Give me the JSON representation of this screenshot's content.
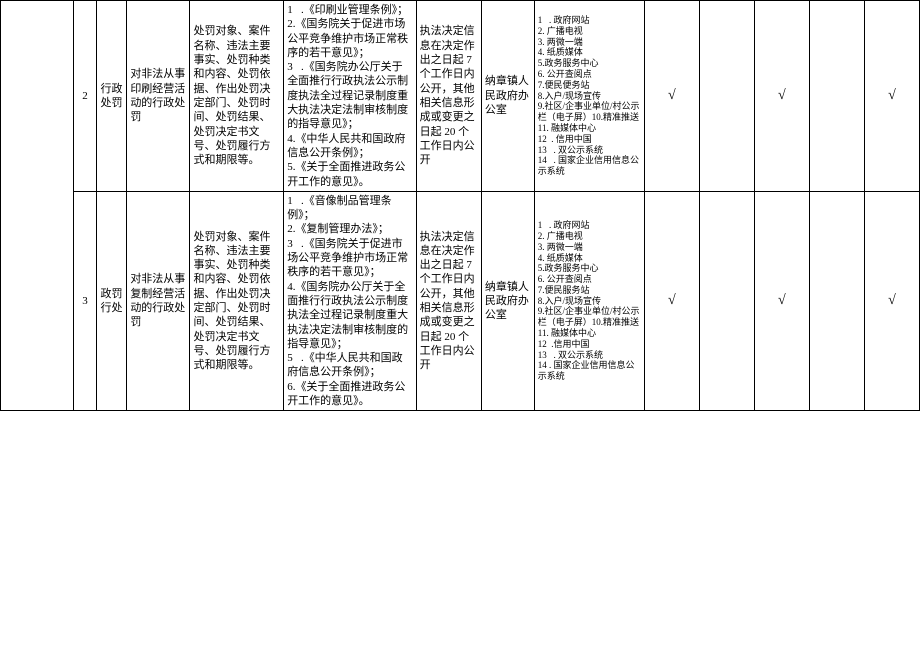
{
  "rows": [
    {
      "num": "2",
      "category": "行政处罚",
      "title": "对非法从事印刷经营活动的行政处罚",
      "content": "处罚对象、案件名称、违法主要事实、处罚种类和内容、处罚依据、作出处罚决定部门、处罚时间、处罚结果、处罚决定书文号、处罚履行方式和期限等。",
      "basis": "1   .《印刷业管理条例》；\n2.《国务院关于促进市场公平竞争维护市场正常秩序的若干意见》；\n3   .《国务院办公厅关于全面推行行政执法公示制度执法全过程记录制度重大执法决定法制审核制度的指导意见》；\n4.《中华人民共和国政府信息公开条例》；\n5.《关于全面推进政务公开工作的意见》。",
      "timing": "执法决定信息在决定作出之日起 7 个工作日内公开，其他相关信息形成或变更之日起 20 个工作日内公开",
      "dept": "纳章镇人民政府办公室",
      "channels": "1   . 政府网站\n2. 广播电视\n3. 两微一端\n4. 纸质媒体\n5.政务服务中心\n6. 公开查阅点\n7.便民便务站\n8.入户/现场宣传\n9.社区/企事业单位/村公示栏（电子屏）10.精准推送\n11. 融媒体中心\n12  . 信用中国\n13   . 双公示系统\n14   . 国家企业信用信息公示系统",
      "check1": "√",
      "check2": "√",
      "check3": "√"
    },
    {
      "num": "3",
      "category": "政罚行处",
      "title": "对非法从事复制经营活动的行政处罚",
      "content": "处罚对象、案件名称、违法主要事实、处罚种类和内容、处罚依据、作出处罚决定部门、处罚时间、处罚结果、处罚决定书文号、处罚履行方式和期限等。",
      "basis": "1   .《音像制品管理条例》；\n2.《复制管理办法》；\n3   .《国务院关于促进市场公平竞争维护市场正常秩序的若干意见》；\n4.《国务院办公厅关于全面推行行政执法公示制度执法全过程记录制度重大执法决定法制审核制度的指导意见》；\n5   .《中华人民共和国政府信息公开条例》；\n6.《关于全面推进政务公开工作的意见》。",
      "timing": "执法决定信息在决定作出之日起 7 个工作日内公开，其他相关信息形成或变更之日起 20 个工作日内公开",
      "dept": "纳章镇人民政府办公室",
      "channels": "1   . 政府网站\n2. 广播电视\n3. 两微一端\n4. 纸质媒体\n5.政务服务中心\n6. 公开查阅点\n7.便民服务站\n8.入户/现场宣传\n9.社区/企事业单位/村公示栏（电子屏）10.精准推送\n11. 融媒体中心\n12  .信用中国\n13   . 双公示系统\n14 . 国家企业信用信息公示系统",
      "check1": "√",
      "check2": "√",
      "check3": "√"
    }
  ]
}
